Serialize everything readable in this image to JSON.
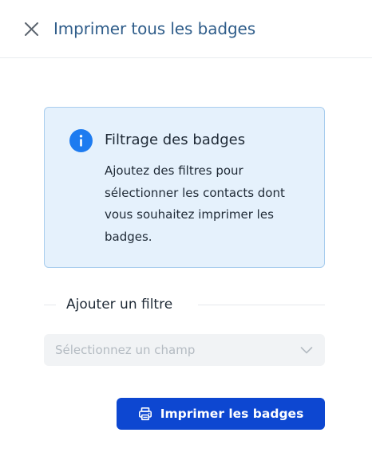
{
  "header": {
    "title": "Imprimer tous les badges",
    "close_icon": "close-icon"
  },
  "info": {
    "icon": "info-icon",
    "title": "Filtrage des badges",
    "text": "Ajoutez des filtres pour sélectionner les contacts dont vous souhaitez imprimer les badges.",
    "accent_color": "#1d7bf0",
    "background_color": "#e5f1fc"
  },
  "filter": {
    "heading": "Ajouter un filtre",
    "select_placeholder": "Sélectionnez un champ",
    "select_icon": "chevron-down-icon"
  },
  "actions": {
    "print_label": "Imprimer les badges",
    "print_icon": "printer-icon",
    "button_color": "#0d47d1"
  }
}
